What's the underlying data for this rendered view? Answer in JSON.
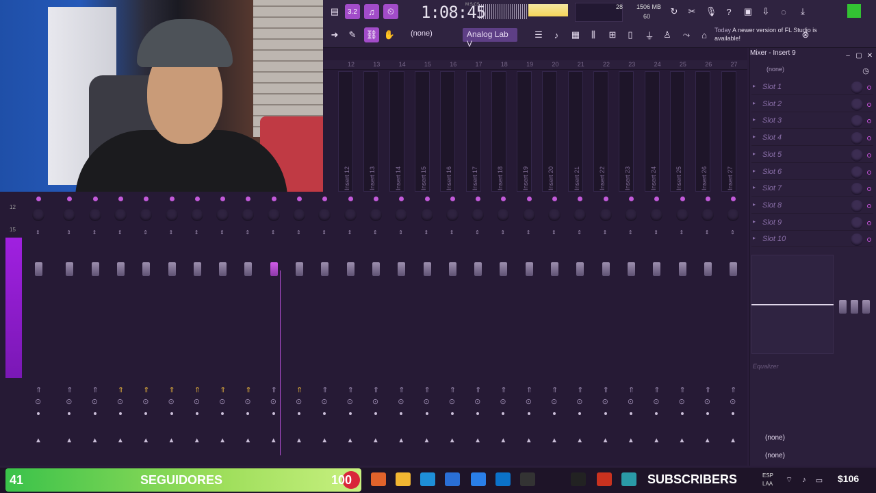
{
  "toolbar": {
    "time": "1:08:45",
    "bars_label": "M:S:CS",
    "cpu": "28",
    "memory": "1506 MB",
    "polyphony": "60",
    "pattern": "(none)",
    "plugin": "Analog Lab V",
    "news_date": "Today",
    "news_text": "A newer version of FL Studio is available!",
    "tempo_button": "3.2"
  },
  "mixer": {
    "ruler": [
      "12",
      "13",
      "14",
      "15",
      "16",
      "17",
      "18",
      "19",
      "20",
      "21",
      "22",
      "23",
      "24",
      "25",
      "26",
      "27"
    ],
    "tracks": [
      "Insert 12",
      "Insert 13",
      "Insert 14",
      "Insert 15",
      "Insert 16",
      "Insert 17",
      "Insert 18",
      "Insert 19",
      "Insert 20",
      "Insert 21",
      "Insert 22",
      "Insert 23",
      "Insert 24",
      "Insert 25",
      "Insert 26",
      "Insert 27"
    ],
    "vu_top": "12",
    "vu_mid": "15"
  },
  "panel": {
    "title": "Mixer - Insert 9",
    "top_select": "(none)",
    "slots": [
      "Slot 1",
      "Slot 2",
      "Slot 3",
      "Slot 4",
      "Slot 5",
      "Slot 6",
      "Slot 7",
      "Slot 8",
      "Slot 9",
      "Slot 10"
    ],
    "equalizer_label": "Equalizer",
    "bottom_in": "(none)",
    "bottom_out": "(none)"
  },
  "overlay": {
    "count": "41",
    "count_label": "SEGUIDORES",
    "goal": "100",
    "subs": "SUBSCRIBERS",
    "money": "$106",
    "lang": "ESP",
    "lang2": "LAA"
  },
  "colors": {
    "accent": "#b04ed1",
    "bg": "#261a35",
    "panel": "#2b1f3b"
  }
}
